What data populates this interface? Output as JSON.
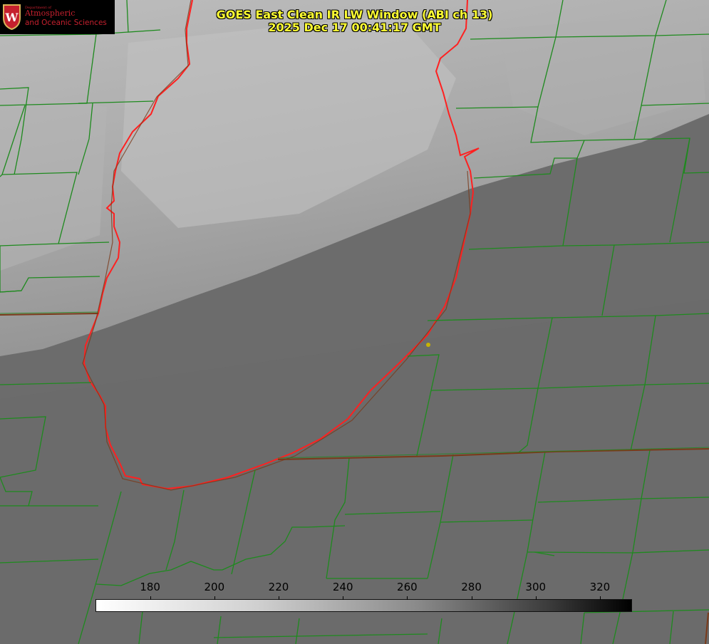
{
  "title": {
    "line1": "GOES East Clean IR LW Window (ABI ch 13)",
    "line2": "2025 Dec 17 00:41:17 GMT"
  },
  "logo": {
    "dept": "Department of",
    "org_line1": "Atmospheric",
    "org_line2": "and Oceanic Sciences",
    "crest_letter": "W"
  },
  "colorbar": {
    "ticks": [
      "180",
      "200",
      "220",
      "240",
      "260",
      "280",
      "300",
      "320"
    ],
    "range": [
      163,
      330
    ],
    "gradient": "white-to-black"
  },
  "colors": {
    "title": "#ffff33",
    "county_lines": "#1e7d1e",
    "lake_outline": "#ff2020",
    "state_line": "#8a3a1a",
    "marker": "#c8b400"
  }
}
